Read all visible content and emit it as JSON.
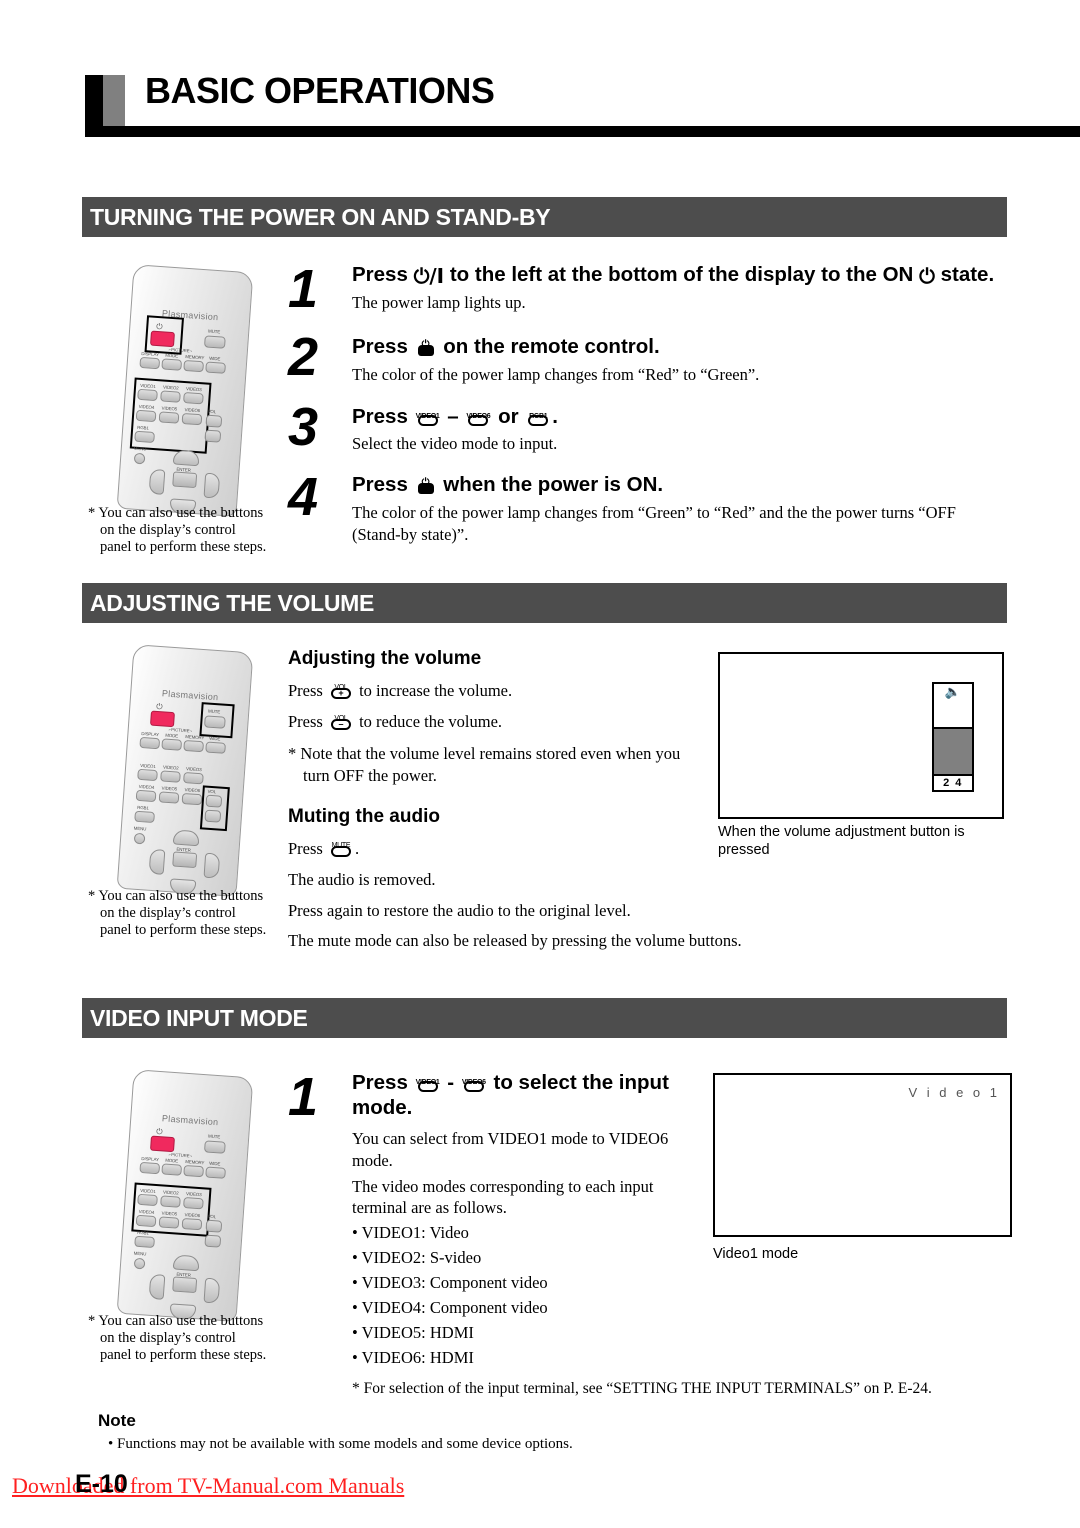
{
  "page": {
    "title": "BASIC OPERATIONS",
    "number": "E-10",
    "watermark": "Downloaded from TV-Manual.com Manuals"
  },
  "sections": {
    "power": {
      "header": "TURNING THE POWER ON AND STAND-BY",
      "steps": [
        {
          "num": "1",
          "head_a": "Press",
          "head_power_sym": "⏻/I",
          "head_b": "to the left at the bottom of the display to the ON",
          "head_power_sym2": "⏻",
          "head_c": "state.",
          "body": "The power lamp lights up."
        },
        {
          "num": "2",
          "head_a": "Press",
          "head_b": "on the remote control.",
          "body": "The color of the power lamp changes from “Red” to “Green”."
        },
        {
          "num": "3",
          "head_a": "Press",
          "btn1": "VIDEO1",
          "dash": "–",
          "btn2": "VIDEO6",
          "or": "or",
          "btn3": "RGB1",
          "period": ".",
          "body": "Select the video mode to input."
        },
        {
          "num": "4",
          "head_a": "Press",
          "head_b": "when the power is ON.",
          "body": "The color of the power lamp changes from “Green” to “Red” and the the power turns “OFF (Stand-by state)”."
        }
      ],
      "remote_note_line1": "* You can also use the buttons",
      "remote_note_line2": "on the display’s control",
      "remote_note_line3": "panel to perform these steps."
    },
    "volume": {
      "header": "ADJUSTING THE VOLUME",
      "sub_adjust": "Adjusting the volume",
      "line_increase_pre": "Press",
      "line_increase_btn_top": "VOL",
      "line_increase_btn_sym": "+",
      "line_increase_post": "to increase the volume.",
      "line_reduce_pre": "Press",
      "line_reduce_btn_top": "VOL",
      "line_reduce_btn_sym": "–",
      "line_reduce_post": "to reduce the volume.",
      "note_line1": "* Note that the volume level remains stored even when you",
      "note_line2": "turn OFF the power.",
      "sub_mute": "Muting the audio",
      "mute_pre": "Press",
      "mute_btn_top": "MUTE",
      "mute_post": ".",
      "mute_line1": "The audio is removed.",
      "mute_line2": "Press again to restore the audio to the original level.",
      "mute_line3": "The mute mode can also be released by pressing the volume buttons.",
      "remote_note_line1": "* You can also use the buttons",
      "remote_note_line2": "on the display’s control",
      "remote_note_line3": "panel to perform these steps.",
      "osd": {
        "speaker_icon": "speaker-icon",
        "value": "2 4",
        "caption_line1": "When the volume adjustment button is",
        "caption_line2": "pressed"
      }
    },
    "video_input": {
      "header": "VIDEO INPUT MODE",
      "step": {
        "num": "1",
        "head_a": "Press",
        "btn1": "VIDEO1",
        "dash": "-",
        "btn2": "VIDEO6",
        "head_b": "to select the input",
        "head_c": "mode.",
        "body_line1": "You can select from VIDEO1 mode to VIDEO6",
        "body_line2": "mode.",
        "body_line3": "The video modes corresponding to each input",
        "body_line4": "terminal are as follows.",
        "bullets": [
          "• VIDEO1: Video",
          "• VIDEO2: S-video",
          "• VIDEO3: Component video",
          "• VIDEO4: Component video",
          "• VIDEO5: HDMI",
          "• VIDEO6: HDMI"
        ],
        "footnote": "* For selection of the input terminal, see “SETTING THE INPUT TERMINALS” on P. E-24."
      },
      "remote_note_line1": "* You can also use the buttons",
      "remote_note_line2": "on the display’s control",
      "remote_note_line3": "panel to perform these steps.",
      "osd": {
        "mode_label": "V i d e o 1",
        "caption": "Video1 mode"
      }
    },
    "note": {
      "heading": "Note",
      "item": "• Functions may not be available with some models and some device options."
    }
  },
  "remote": {
    "brand": "Plasmavision",
    "power_glyph": "⏻",
    "buttons": {
      "mute": "MUTE",
      "display": "DISPLAY",
      "mode": "MODE",
      "memory": "MEMORY",
      "wide": "WIDE",
      "picture_bracket": "⌐PICTURE¬",
      "video1": "VIDEO1",
      "video2": "VIDEO2",
      "video3": "VIDEO3",
      "video4": "VIDEO4",
      "video5": "VIDEO5",
      "video6": "VIDEO6",
      "rgb1": "RGB1",
      "vol": "VOL",
      "vol_plus": "+",
      "vol_minus": "–",
      "menu": "MENU",
      "enter": "ENTER"
    }
  },
  "colors": {
    "section_bar": "#4d4d4d",
    "power_button": "#f0295e",
    "volume_fill": "#808080",
    "watermark": "#ff2020"
  }
}
